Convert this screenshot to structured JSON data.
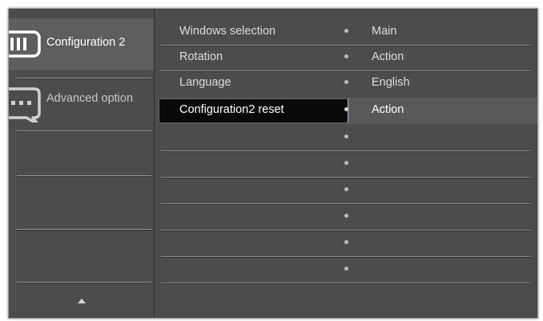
{
  "sidebar": {
    "items": [
      {
        "label": "Configuration 2",
        "icon": "monitor-icon",
        "selected": true
      },
      {
        "label": "Advanced option",
        "icon": "chat-bubble-icon",
        "selected": false
      }
    ],
    "scroll_icon": "up-arrow-icon"
  },
  "settings": {
    "rows": [
      {
        "name": "Windows selection",
        "value": "Main"
      },
      {
        "name": "Rotation",
        "value": "Action"
      },
      {
        "name": "Language",
        "value": "English"
      },
      {
        "name": "Configuration2 reset",
        "value": "Action",
        "selected": true
      },
      {
        "name": "",
        "value": ""
      },
      {
        "name": "",
        "value": ""
      },
      {
        "name": "",
        "value": ""
      },
      {
        "name": "",
        "value": ""
      },
      {
        "name": "",
        "value": ""
      },
      {
        "name": "",
        "value": ""
      }
    ]
  },
  "colors": {
    "background": "#4c4c4c",
    "selected_row": "#0a0a0a",
    "text": "#dcdcdc"
  }
}
